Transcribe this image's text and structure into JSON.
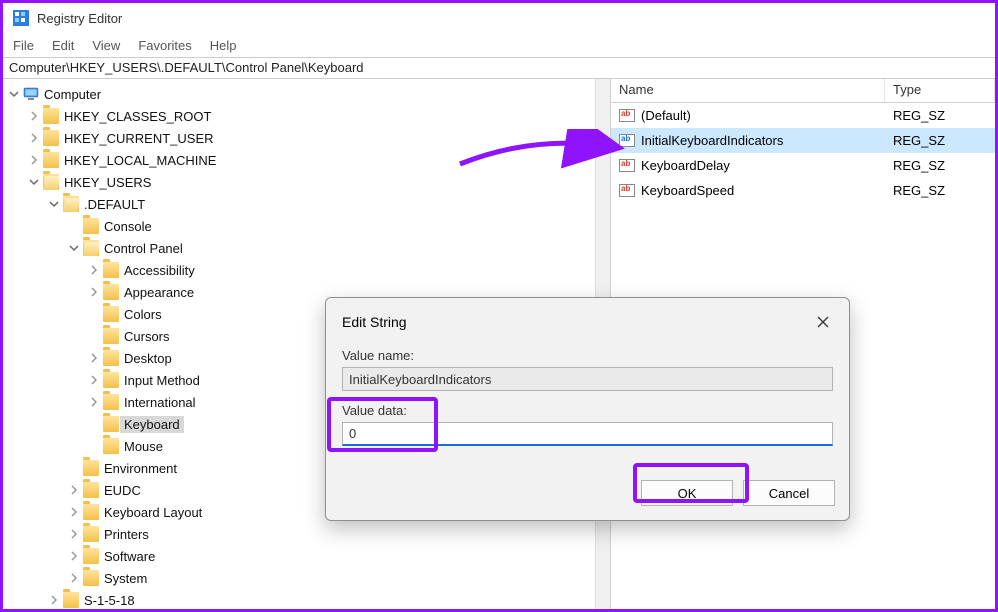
{
  "app": {
    "title": "Registry Editor"
  },
  "menu": {
    "file": "File",
    "edit": "Edit",
    "view": "View",
    "favorites": "Favorites",
    "help": "Help"
  },
  "address": "Computer\\HKEY_USERS\\.DEFAULT\\Control Panel\\Keyboard",
  "tree": {
    "computer": "Computer",
    "hkcr": "HKEY_CLASSES_ROOT",
    "hkcu": "HKEY_CURRENT_USER",
    "hklm": "HKEY_LOCAL_MACHINE",
    "hku": "HKEY_USERS",
    "default": ".DEFAULT",
    "console": "Console",
    "control_panel": "Control Panel",
    "cp": {
      "accessibility": "Accessibility",
      "appearance": "Appearance",
      "colors": "Colors",
      "cursors": "Cursors",
      "desktop": "Desktop",
      "input_method": "Input Method",
      "international": "International",
      "keyboard": "Keyboard",
      "mouse": "Mouse"
    },
    "environment": "Environment",
    "eudc": "EUDC",
    "keyboard_layout": "Keyboard Layout",
    "printers": "Printers",
    "software": "Software",
    "system": "System",
    "s1518": "S-1-5-18"
  },
  "list": {
    "header": {
      "name": "Name",
      "type": "Type"
    },
    "rows": [
      {
        "name": "(Default)",
        "type": "REG_SZ"
      },
      {
        "name": "InitialKeyboardIndicators",
        "type": "REG_SZ"
      },
      {
        "name": "KeyboardDelay",
        "type": "REG_SZ"
      },
      {
        "name": "KeyboardSpeed",
        "type": "REG_SZ"
      }
    ]
  },
  "dialog": {
    "title": "Edit String",
    "value_name_label": "Value name:",
    "value_name": "InitialKeyboardIndicators",
    "value_data_label": "Value data:",
    "value_data": "0",
    "ok": "OK",
    "cancel": "Cancel"
  }
}
